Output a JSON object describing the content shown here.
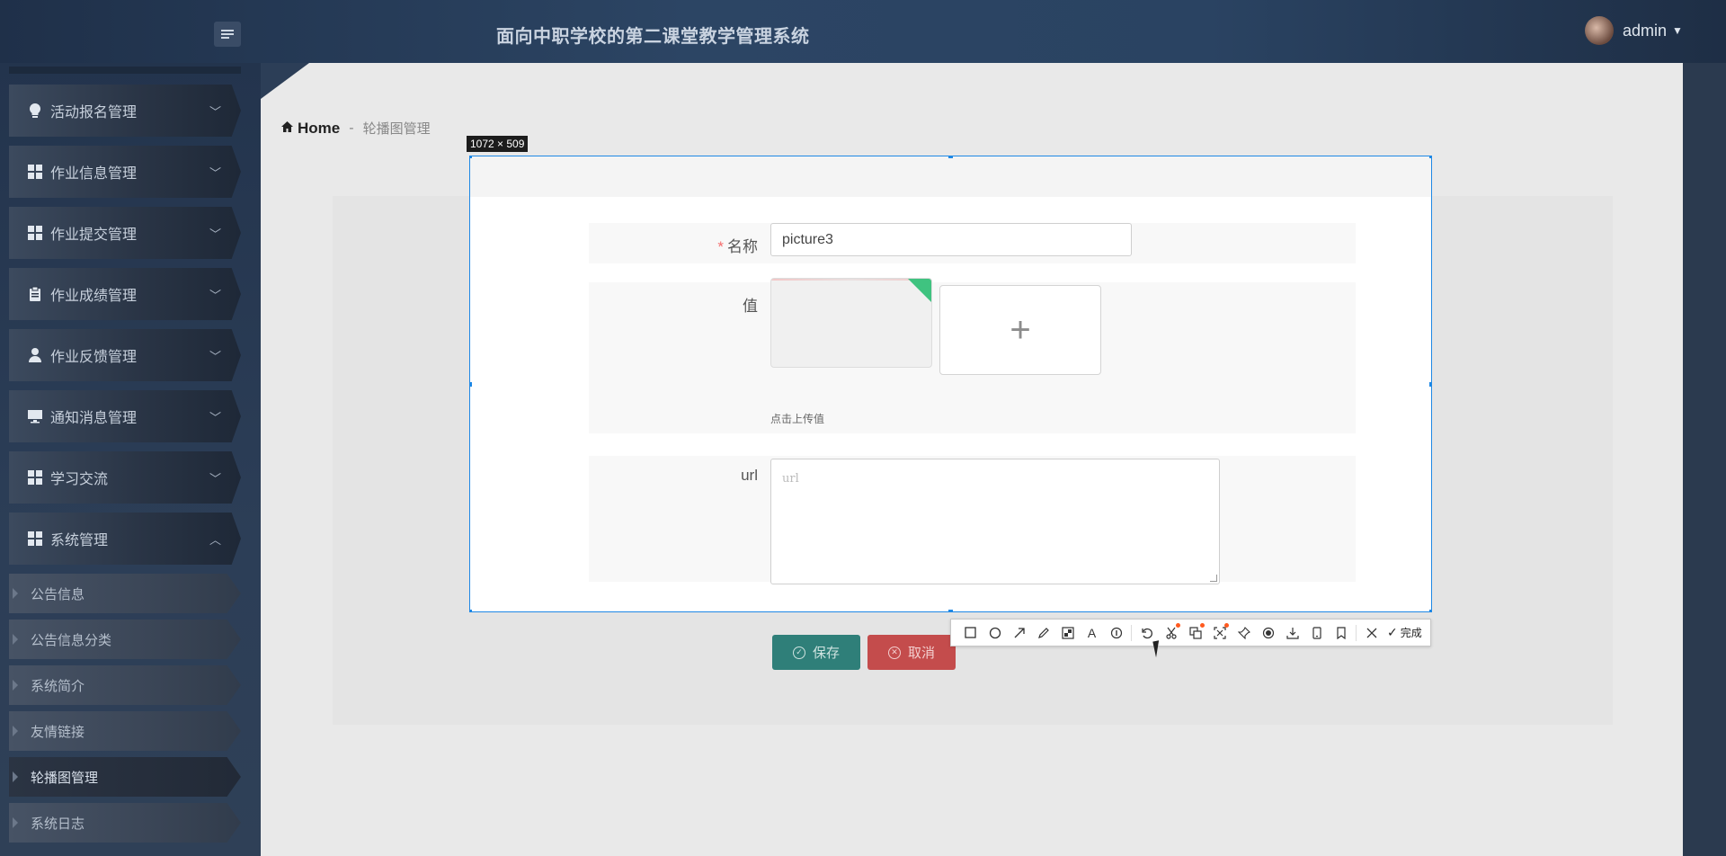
{
  "header": {
    "title": "面向中职学校的第二课堂教学管理系统",
    "user": "admin"
  },
  "sidebar": {
    "menus": [
      {
        "label": "活动报名管理",
        "icon": "lightbulb-icon"
      },
      {
        "label": "作业信息管理",
        "icon": "grid-icon"
      },
      {
        "label": "作业提交管理",
        "icon": "grid-icon"
      },
      {
        "label": "作业成绩管理",
        "icon": "clipboard-icon"
      },
      {
        "label": "作业反馈管理",
        "icon": "user-icon"
      },
      {
        "label": "通知消息管理",
        "icon": "monitor-icon"
      },
      {
        "label": "学习交流",
        "icon": "grid-icon"
      },
      {
        "label": "系统管理",
        "icon": "grid-icon"
      }
    ],
    "sub_items": [
      "公告信息",
      "公告信息分类",
      "系统简介",
      "友情链接",
      "轮播图管理",
      "系统日志"
    ],
    "active_sub": "轮播图管理"
  },
  "breadcrumb": {
    "home": "Home",
    "separator": "-",
    "current": "轮播图管理"
  },
  "selection": {
    "size_label": "1072 × 509"
  },
  "form": {
    "name_label": "名称",
    "name_required_mark": "*",
    "name_value": "picture3",
    "value_label": "值",
    "upload_plus": "+",
    "upload_hint": "点击上传值",
    "url_label": "url",
    "url_placeholder": "url"
  },
  "buttons": {
    "save": "保存",
    "cancel": "取消"
  },
  "toolbar": {
    "done": "完成",
    "tools": [
      "rectangle-icon",
      "ellipse-icon",
      "arrow-icon",
      "pencil-icon",
      "mosaic-icon",
      "text-icon",
      "number-icon",
      "undo-icon",
      "cut-icon",
      "translate-icon",
      "ocr-icon",
      "pin-icon",
      "record-icon",
      "download-icon",
      "phone-icon",
      "bookmark-icon",
      "close-icon",
      "done-icon"
    ]
  },
  "colors": {
    "accent": "#1e88e5",
    "save": "#2f7f79",
    "cancel": "#c44c4c",
    "required": "#f56c6c"
  }
}
